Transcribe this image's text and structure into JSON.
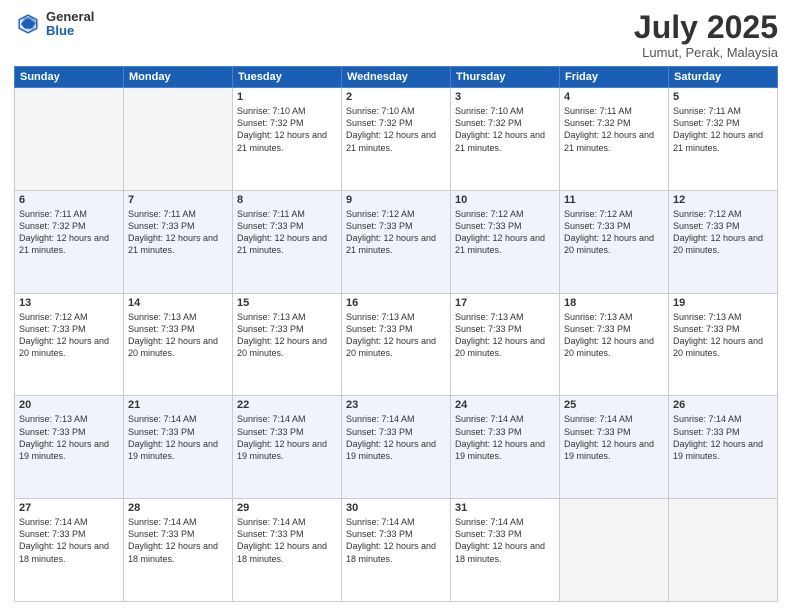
{
  "header": {
    "logo_general": "General",
    "logo_blue": "Blue",
    "month_title": "July 2025",
    "location": "Lumut, Perak, Malaysia"
  },
  "weekdays": [
    "Sunday",
    "Monday",
    "Tuesday",
    "Wednesday",
    "Thursday",
    "Friday",
    "Saturday"
  ],
  "weeks": [
    {
      "days": [
        {
          "num": "",
          "info": ""
        },
        {
          "num": "",
          "info": ""
        },
        {
          "num": "1",
          "info": "Sunrise: 7:10 AM\nSunset: 7:32 PM\nDaylight: 12 hours\nand 21 minutes."
        },
        {
          "num": "2",
          "info": "Sunrise: 7:10 AM\nSunset: 7:32 PM\nDaylight: 12 hours\nand 21 minutes."
        },
        {
          "num": "3",
          "info": "Sunrise: 7:10 AM\nSunset: 7:32 PM\nDaylight: 12 hours\nand 21 minutes."
        },
        {
          "num": "4",
          "info": "Sunrise: 7:11 AM\nSunset: 7:32 PM\nDaylight: 12 hours\nand 21 minutes."
        },
        {
          "num": "5",
          "info": "Sunrise: 7:11 AM\nSunset: 7:32 PM\nDaylight: 12 hours\nand 21 minutes."
        }
      ]
    },
    {
      "days": [
        {
          "num": "6",
          "info": "Sunrise: 7:11 AM\nSunset: 7:32 PM\nDaylight: 12 hours\nand 21 minutes."
        },
        {
          "num": "7",
          "info": "Sunrise: 7:11 AM\nSunset: 7:33 PM\nDaylight: 12 hours\nand 21 minutes."
        },
        {
          "num": "8",
          "info": "Sunrise: 7:11 AM\nSunset: 7:33 PM\nDaylight: 12 hours\nand 21 minutes."
        },
        {
          "num": "9",
          "info": "Sunrise: 7:12 AM\nSunset: 7:33 PM\nDaylight: 12 hours\nand 21 minutes."
        },
        {
          "num": "10",
          "info": "Sunrise: 7:12 AM\nSunset: 7:33 PM\nDaylight: 12 hours\nand 21 minutes."
        },
        {
          "num": "11",
          "info": "Sunrise: 7:12 AM\nSunset: 7:33 PM\nDaylight: 12 hours\nand 20 minutes."
        },
        {
          "num": "12",
          "info": "Sunrise: 7:12 AM\nSunset: 7:33 PM\nDaylight: 12 hours\nand 20 minutes."
        }
      ]
    },
    {
      "days": [
        {
          "num": "13",
          "info": "Sunrise: 7:12 AM\nSunset: 7:33 PM\nDaylight: 12 hours\nand 20 minutes."
        },
        {
          "num": "14",
          "info": "Sunrise: 7:13 AM\nSunset: 7:33 PM\nDaylight: 12 hours\nand 20 minutes."
        },
        {
          "num": "15",
          "info": "Sunrise: 7:13 AM\nSunset: 7:33 PM\nDaylight: 12 hours\nand 20 minutes."
        },
        {
          "num": "16",
          "info": "Sunrise: 7:13 AM\nSunset: 7:33 PM\nDaylight: 12 hours\nand 20 minutes."
        },
        {
          "num": "17",
          "info": "Sunrise: 7:13 AM\nSunset: 7:33 PM\nDaylight: 12 hours\nand 20 minutes."
        },
        {
          "num": "18",
          "info": "Sunrise: 7:13 AM\nSunset: 7:33 PM\nDaylight: 12 hours\nand 20 minutes."
        },
        {
          "num": "19",
          "info": "Sunrise: 7:13 AM\nSunset: 7:33 PM\nDaylight: 12 hours\nand 20 minutes."
        }
      ]
    },
    {
      "days": [
        {
          "num": "20",
          "info": "Sunrise: 7:13 AM\nSunset: 7:33 PM\nDaylight: 12 hours\nand 19 minutes."
        },
        {
          "num": "21",
          "info": "Sunrise: 7:14 AM\nSunset: 7:33 PM\nDaylight: 12 hours\nand 19 minutes."
        },
        {
          "num": "22",
          "info": "Sunrise: 7:14 AM\nSunset: 7:33 PM\nDaylight: 12 hours\nand 19 minutes."
        },
        {
          "num": "23",
          "info": "Sunrise: 7:14 AM\nSunset: 7:33 PM\nDaylight: 12 hours\nand 19 minutes."
        },
        {
          "num": "24",
          "info": "Sunrise: 7:14 AM\nSunset: 7:33 PM\nDaylight: 12 hours\nand 19 minutes."
        },
        {
          "num": "25",
          "info": "Sunrise: 7:14 AM\nSunset: 7:33 PM\nDaylight: 12 hours\nand 19 minutes."
        },
        {
          "num": "26",
          "info": "Sunrise: 7:14 AM\nSunset: 7:33 PM\nDaylight: 12 hours\nand 19 minutes."
        }
      ]
    },
    {
      "days": [
        {
          "num": "27",
          "info": "Sunrise: 7:14 AM\nSunset: 7:33 PM\nDaylight: 12 hours\nand 18 minutes."
        },
        {
          "num": "28",
          "info": "Sunrise: 7:14 AM\nSunset: 7:33 PM\nDaylight: 12 hours\nand 18 minutes."
        },
        {
          "num": "29",
          "info": "Sunrise: 7:14 AM\nSunset: 7:33 PM\nDaylight: 12 hours\nand 18 minutes."
        },
        {
          "num": "30",
          "info": "Sunrise: 7:14 AM\nSunset: 7:33 PM\nDaylight: 12 hours\nand 18 minutes."
        },
        {
          "num": "31",
          "info": "Sunrise: 7:14 AM\nSunset: 7:33 PM\nDaylight: 12 hours\nand 18 minutes."
        },
        {
          "num": "",
          "info": ""
        },
        {
          "num": "",
          "info": ""
        }
      ]
    }
  ]
}
